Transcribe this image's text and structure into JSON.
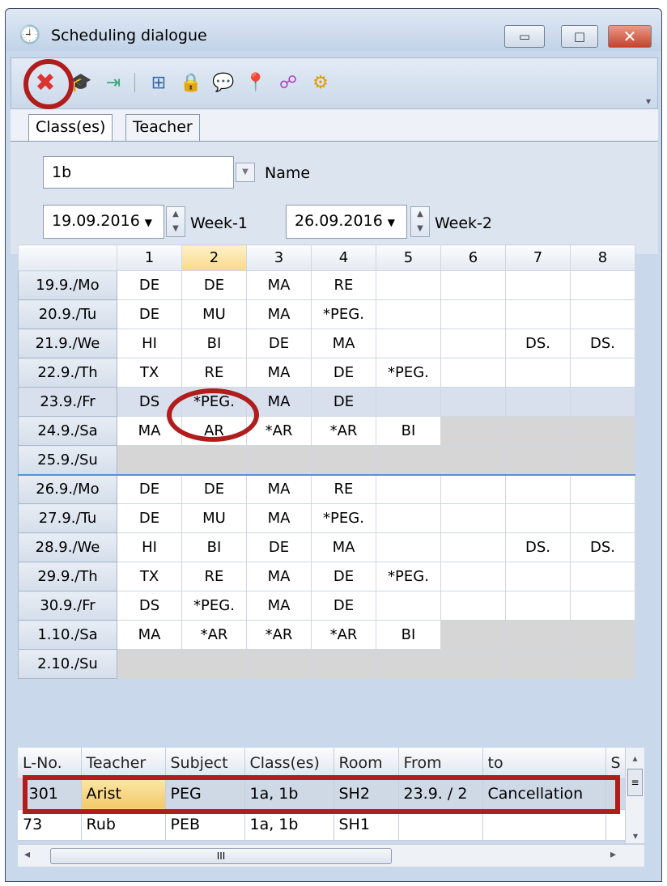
{
  "window": {
    "title": "Scheduling dialogue",
    "minimize": "▭",
    "maximize": "□",
    "close": "✕"
  },
  "toolbar": {
    "icons": [
      "delete-icon",
      "teacher-hat-icon",
      "import-icon",
      "layout-icon",
      "lock-icon",
      "messages-icon",
      "pin-icon",
      "network-icon",
      "settings-gear-icon"
    ]
  },
  "tabs": [
    "Class(es)",
    "Teacher"
  ],
  "filter": {
    "name_value": "1b",
    "name_label": "Name",
    "date1": "19.09.2016",
    "week1": "Week-1",
    "date2": "26.09.2016",
    "week2": "Week-2"
  },
  "grid": {
    "columns": [
      "1",
      "2",
      "3",
      "4",
      "5",
      "6",
      "7",
      "8"
    ],
    "rows": [
      {
        "day": "19.9./Mo",
        "cells": [
          "DE",
          "DE",
          "MA",
          "RE",
          "",
          "",
          "",
          ""
        ]
      },
      {
        "day": "20.9./Tu",
        "cells": [
          "DE",
          "MU",
          "MA",
          "*PEG.",
          "",
          "",
          "",
          ""
        ]
      },
      {
        "day": "21.9./We",
        "cells": [
          "HI",
          "BI",
          "DE",
          "MA",
          "",
          "",
          "DS.",
          "DS."
        ]
      },
      {
        "day": "22.9./Th",
        "cells": [
          "TX",
          "RE",
          "MA",
          "DE",
          "*PEG.",
          "",
          "",
          ""
        ]
      },
      {
        "day": "23.9./Fr",
        "cells": [
          "DS",
          "*PEG.",
          "MA",
          "DE",
          "",
          "",
          "",
          ""
        ]
      },
      {
        "day": "24.9./Sa",
        "cells": [
          "MA",
          "AR",
          "*AR",
          "*AR",
          "BI",
          "",
          "",
          ""
        ]
      },
      {
        "day": "25.9./Su",
        "cells": [
          "",
          "",
          "",
          "",
          "",
          "",
          "",
          ""
        ]
      },
      {
        "day": "26.9./Mo",
        "cells": [
          "DE",
          "DE",
          "MA",
          "RE",
          "",
          "",
          "",
          ""
        ]
      },
      {
        "day": "27.9./Tu",
        "cells": [
          "DE",
          "MU",
          "MA",
          "*PEG.",
          "",
          "",
          "",
          ""
        ]
      },
      {
        "day": "28.9./We",
        "cells": [
          "HI",
          "BI",
          "DE",
          "MA",
          "",
          "",
          "DS.",
          "DS."
        ]
      },
      {
        "day": "29.9./Th",
        "cells": [
          "TX",
          "RE",
          "MA",
          "DE",
          "*PEG.",
          "",
          "",
          ""
        ]
      },
      {
        "day": "30.9./Fr",
        "cells": [
          "DS",
          "*PEG.",
          "MA",
          "DE",
          "",
          "",
          "",
          ""
        ]
      },
      {
        "day": "1.10./Sa",
        "cells": [
          "MA",
          "*AR",
          "*AR",
          "*AR",
          "BI",
          "",
          "",
          ""
        ]
      },
      {
        "day": "2.10./Su",
        "cells": [
          "",
          "",
          "",
          "",
          "",
          "",
          "",
          ""
        ]
      }
    ]
  },
  "lessons": {
    "headers": [
      "L-No.",
      "Teacher",
      "Subject",
      "Class(es)",
      "Room",
      "From",
      "to",
      "S"
    ],
    "rows": [
      [
        "!301",
        "Arist",
        "PEG",
        "1a, 1b",
        "SH2",
        "23.9. / 2",
        "Cancellation"
      ],
      [
        "73",
        "Rub",
        "PEB",
        "1a, 1b",
        "SH1",
        "",
        ""
      ]
    ]
  },
  "scroll": {
    "thumb": "III",
    "left": "◂",
    "right": "▸",
    "up": "▴",
    "down": "▾"
  }
}
